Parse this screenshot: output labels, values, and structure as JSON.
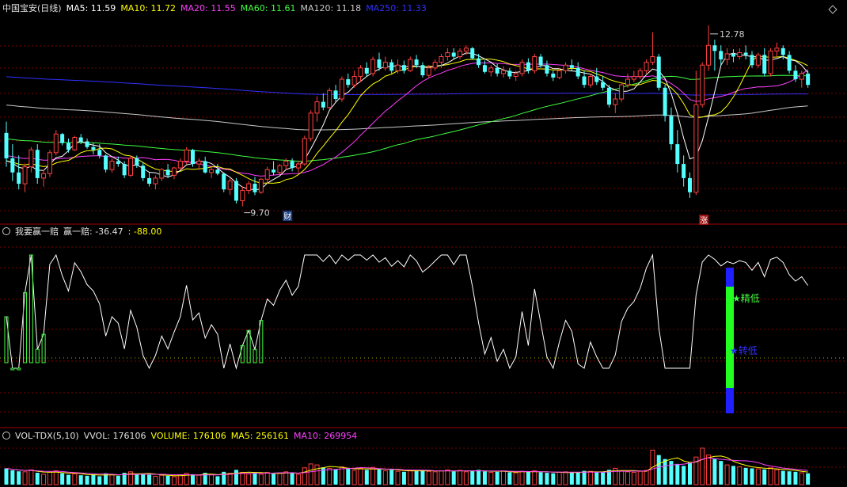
{
  "header_main": {
    "title": "中国宝安(日线)",
    "ma5": "MA5: 11.59",
    "ma10": "MA10: 11.72",
    "ma20": "MA20: 11.55",
    "ma60": "MA60: 11.61",
    "ma120": "MA120: 11.18",
    "ma250": "MA250: 11.33"
  },
  "header_ind": {
    "title": "我要赢一赔",
    "line": "赢一赔: -36.47",
    "extra": ": -88.00"
  },
  "header_vol": {
    "title": "VOL-TDX(5,10)",
    "vvol": "VVOL: 176106",
    "volume": "VOLUME: 176106",
    "ma5": "MA5: 256161",
    "ma10": "MA10: 269954"
  },
  "annotations": {
    "high": "12.78",
    "low": "9.70",
    "cai": "财",
    "zhang": "涨",
    "jingdi": "精低",
    "zhuandi": "转低"
  },
  "colors": {
    "up": "#ff4040",
    "down": "#54ffff",
    "ma5": "#ffffff",
    "ma10": "#ffff00",
    "ma20": "#ff40ff",
    "ma60": "#40ff40",
    "ma120": "#c8c8c8",
    "ma250": "#3030ff",
    "grid": "#7a0000"
  },
  "chart_data": {
    "type": "candlestick",
    "ylim": [
      9.4,
      13.1
    ],
    "candles": [
      [
        11.0,
        11.2,
        10.4,
        10.55
      ],
      [
        10.55,
        10.8,
        10.15,
        10.3
      ],
      [
        10.3,
        10.6,
        10.0,
        10.1
      ],
      [
        10.1,
        10.45,
        9.95,
        10.4
      ],
      [
        10.4,
        10.75,
        10.3,
        10.7
      ],
      [
        10.7,
        10.8,
        10.1,
        10.2
      ],
      [
        10.2,
        10.35,
        10.05,
        10.28
      ],
      [
        10.28,
        10.7,
        10.22,
        10.65
      ],
      [
        10.65,
        11.05,
        10.6,
        10.98
      ],
      [
        10.98,
        11.0,
        10.78,
        10.82
      ],
      [
        10.82,
        10.9,
        10.65,
        10.7
      ],
      [
        10.7,
        10.95,
        10.68,
        10.92
      ],
      [
        10.92,
        10.98,
        10.8,
        10.85
      ],
      [
        10.85,
        10.9,
        10.72,
        10.75
      ],
      [
        10.75,
        10.82,
        10.62,
        10.7
      ],
      [
        10.7,
        10.8,
        10.55,
        10.6
      ],
      [
        10.6,
        10.62,
        10.3,
        10.35
      ],
      [
        10.35,
        10.55,
        10.3,
        10.5
      ],
      [
        10.5,
        10.58,
        10.4,
        10.45
      ],
      [
        10.45,
        10.5,
        10.2,
        10.25
      ],
      [
        10.25,
        10.6,
        10.22,
        10.55
      ],
      [
        10.55,
        10.6,
        10.38,
        10.42
      ],
      [
        10.42,
        10.48,
        10.15,
        10.2
      ],
      [
        10.2,
        10.3,
        10.05,
        10.1
      ],
      [
        10.1,
        10.25,
        10.0,
        10.2
      ],
      [
        10.2,
        10.38,
        10.15,
        10.35
      ],
      [
        10.35,
        10.45,
        10.2,
        10.25
      ],
      [
        10.25,
        10.4,
        10.18,
        10.38
      ],
      [
        10.38,
        10.55,
        10.35,
        10.5
      ],
      [
        10.5,
        10.75,
        10.45,
        10.7
      ],
      [
        10.7,
        10.72,
        10.4,
        10.45
      ],
      [
        10.45,
        10.55,
        10.35,
        10.5
      ],
      [
        10.5,
        10.58,
        10.28,
        10.3
      ],
      [
        10.3,
        10.4,
        10.2,
        10.35
      ],
      [
        10.35,
        10.45,
        10.25,
        10.28
      ],
      [
        10.28,
        10.3,
        9.95,
        10.0
      ],
      [
        10.0,
        10.2,
        9.9,
        10.15
      ],
      [
        10.15,
        10.2,
        9.75,
        9.8
      ],
      [
        9.8,
        10.05,
        9.7,
        9.98
      ],
      [
        9.98,
        10.15,
        9.92,
        10.1
      ],
      [
        10.1,
        10.22,
        9.9,
        9.95
      ],
      [
        9.95,
        10.2,
        9.92,
        10.18
      ],
      [
        10.18,
        10.4,
        10.1,
        10.35
      ],
      [
        10.35,
        10.5,
        10.25,
        10.3
      ],
      [
        10.3,
        10.45,
        10.25,
        10.42
      ],
      [
        10.42,
        10.55,
        10.35,
        10.5
      ],
      [
        10.5,
        10.55,
        10.32,
        10.38
      ],
      [
        10.38,
        10.5,
        10.3,
        10.45
      ],
      [
        10.45,
        10.95,
        10.42,
        10.9
      ],
      [
        10.9,
        11.4,
        10.85,
        11.35
      ],
      [
        11.35,
        11.65,
        11.2,
        11.55
      ],
      [
        11.55,
        11.7,
        11.4,
        11.45
      ],
      [
        11.45,
        11.8,
        11.42,
        11.75
      ],
      [
        11.75,
        11.85,
        11.55,
        11.6
      ],
      [
        11.6,
        12.0,
        11.55,
        11.95
      ],
      [
        11.95,
        12.05,
        11.8,
        11.85
      ],
      [
        11.85,
        12.1,
        11.8,
        12.0
      ],
      [
        12.0,
        12.2,
        11.9,
        12.15
      ],
      [
        12.15,
        12.25,
        12.0,
        12.05
      ],
      [
        12.05,
        12.35,
        12.0,
        12.3
      ],
      [
        12.3,
        12.42,
        12.1,
        12.15
      ],
      [
        12.15,
        12.35,
        12.1,
        12.25
      ],
      [
        12.25,
        12.3,
        12.05,
        12.1
      ],
      [
        12.1,
        12.3,
        12.05,
        12.2
      ],
      [
        12.2,
        12.28,
        12.05,
        12.1
      ],
      [
        12.1,
        12.35,
        12.08,
        12.3
      ],
      [
        12.3,
        12.38,
        12.15,
        12.2
      ],
      [
        12.2,
        12.25,
        11.98,
        12.02
      ],
      [
        12.02,
        12.2,
        11.98,
        12.15
      ],
      [
        12.15,
        12.3,
        12.1,
        12.25
      ],
      [
        12.25,
        12.4,
        12.15,
        12.35
      ],
      [
        12.35,
        12.5,
        12.28,
        12.42
      ],
      [
        12.42,
        12.5,
        12.3,
        12.35
      ],
      [
        12.35,
        12.5,
        12.3,
        12.45
      ],
      [
        12.45,
        12.55,
        12.38,
        12.5
      ],
      [
        12.5,
        12.52,
        12.3,
        12.32
      ],
      [
        12.32,
        12.4,
        12.15,
        12.2
      ],
      [
        12.2,
        12.28,
        12.05,
        12.08
      ],
      [
        12.08,
        12.2,
        12.0,
        12.15
      ],
      [
        12.15,
        12.22,
        12.0,
        12.05
      ],
      [
        12.05,
        12.18,
        11.98,
        12.1
      ],
      [
        12.1,
        12.15,
        11.95,
        12.0
      ],
      [
        12.0,
        12.1,
        11.92,
        12.05
      ],
      [
        12.05,
        12.3,
        12.0,
        12.25
      ],
      [
        12.25,
        12.32,
        12.05,
        12.1
      ],
      [
        12.1,
        12.4,
        12.05,
        12.35
      ],
      [
        12.35,
        12.4,
        12.15,
        12.2
      ],
      [
        12.2,
        12.28,
        12.0,
        12.05
      ],
      [
        12.05,
        12.1,
        11.92,
        11.98
      ],
      [
        11.98,
        12.15,
        11.95,
        12.1
      ],
      [
        12.1,
        12.25,
        12.05,
        12.2
      ],
      [
        12.2,
        12.3,
        12.1,
        12.15
      ],
      [
        12.15,
        12.25,
        11.95,
        12.0
      ],
      [
        12.0,
        12.1,
        11.8,
        11.85
      ],
      [
        11.85,
        12.05,
        11.8,
        12.0
      ],
      [
        12.0,
        12.15,
        11.85,
        11.9
      ],
      [
        11.9,
        12.0,
        11.75,
        11.8
      ],
      [
        11.8,
        11.85,
        11.45,
        11.5
      ],
      [
        11.5,
        11.7,
        11.35,
        11.6
      ],
      [
        11.6,
        11.9,
        11.55,
        11.85
      ],
      [
        11.85,
        12.05,
        11.8,
        11.95
      ],
      [
        11.95,
        12.1,
        11.9,
        12.0
      ],
      [
        12.0,
        12.15,
        11.95,
        12.1
      ],
      [
        12.1,
        12.3,
        12.05,
        12.25
      ],
      [
        12.25,
        12.78,
        12.2,
        12.35
      ],
      [
        12.35,
        12.4,
        11.75,
        11.8
      ],
      [
        11.8,
        11.85,
        11.2,
        11.3
      ],
      [
        11.3,
        11.45,
        10.7,
        10.8
      ],
      [
        10.8,
        11.05,
        10.3,
        10.45
      ],
      [
        10.45,
        10.6,
        10.05,
        10.2
      ],
      [
        10.2,
        10.3,
        9.85,
        9.95
      ],
      [
        9.95,
        12.1,
        9.9,
        11.5
      ],
      [
        11.5,
        12.25,
        11.45,
        12.2
      ],
      [
        12.2,
        12.9,
        12.1,
        12.55
      ],
      [
        12.55,
        12.65,
        12.1,
        12.45
      ],
      [
        12.45,
        12.55,
        12.2,
        12.3
      ],
      [
        12.3,
        12.5,
        12.2,
        12.4
      ],
      [
        12.4,
        12.48,
        12.25,
        12.35
      ],
      [
        12.35,
        12.5,
        12.3,
        12.42
      ],
      [
        12.42,
        12.55,
        12.3,
        12.38
      ],
      [
        12.38,
        12.45,
        12.15,
        12.2
      ],
      [
        12.2,
        12.42,
        12.15,
        12.38
      ],
      [
        12.38,
        12.5,
        12.0,
        12.05
      ],
      [
        12.05,
        12.5,
        12.0,
        12.45
      ],
      [
        12.45,
        12.6,
        12.35,
        12.5
      ],
      [
        12.5,
        12.55,
        12.3,
        12.38
      ],
      [
        12.38,
        12.45,
        12.05,
        12.1
      ],
      [
        12.1,
        12.2,
        11.9,
        11.95
      ],
      [
        11.95,
        12.1,
        11.8,
        12.05
      ],
      [
        12.05,
        12.1,
        11.8,
        11.85
      ]
    ],
    "vol_ylim": [
      0,
      900000
    ],
    "volume": [
      330000,
      290000,
      270000,
      260000,
      300000,
      240000,
      210000,
      250000,
      280000,
      230000,
      200000,
      220000,
      190000,
      180000,
      210000,
      170000,
      230000,
      200000,
      180000,
      240000,
      260000,
      210000,
      220000,
      200000,
      170000,
      190000,
      180000,
      160000,
      200000,
      230000,
      210000,
      190000,
      240000,
      200000,
      170000,
      260000,
      230000,
      300000,
      250000,
      220000,
      240000,
      210000,
      250000,
      220000,
      230000,
      260000,
      240000,
      210000,
      340000,
      420000,
      400000,
      350000,
      330000,
      310000,
      360000,
      320000,
      290000,
      330000,
      300000,
      350000,
      310000,
      280000,
      300000,
      270000,
      260000,
      290000,
      280000,
      300000,
      270000,
      260000,
      280000,
      300000,
      270000,
      290000,
      260000,
      280000,
      300000,
      270000,
      250000,
      260000,
      280000,
      250000,
      240000,
      270000,
      260000,
      280000,
      250000,
      240000,
      230000,
      250000,
      260000,
      240000,
      250000,
      280000,
      270000,
      250000,
      260000,
      300000,
      330000,
      280000,
      260000,
      250000,
      270000,
      290000,
      700000,
      600000,
      520000,
      480000,
      420000,
      380000,
      450000,
      560000,
      740000,
      600000,
      520000,
      480000,
      400000,
      380000,
      360000,
      340000,
      330000,
      320000,
      310000,
      340000,
      300000,
      280000,
      270000,
      260000,
      240000,
      230000
    ]
  }
}
